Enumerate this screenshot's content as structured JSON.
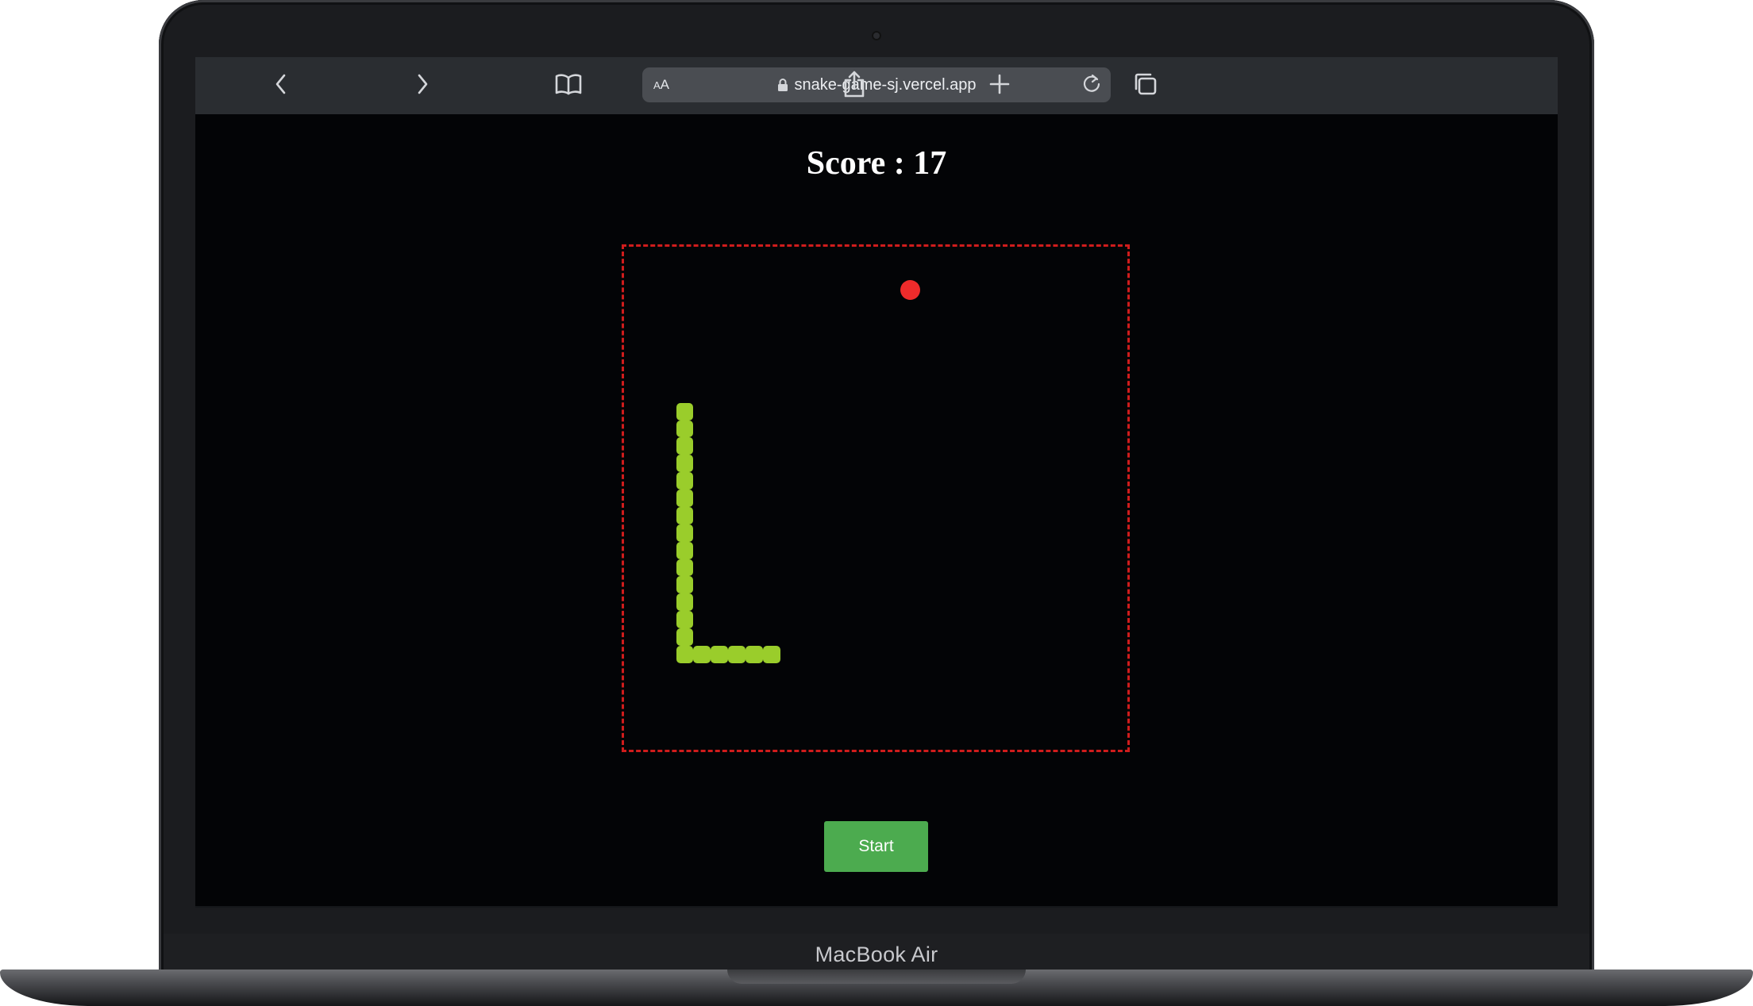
{
  "browser": {
    "text_size_label_small": "A",
    "text_size_label_large": "A",
    "url": "snake-game-sj.vercel.app",
    "icons": {
      "back": "chevron-left-icon",
      "forward": "chevron-right-icon",
      "bookmarks": "book-icon",
      "lock": "lock-icon",
      "reload": "reload-icon",
      "share": "share-icon",
      "new_tab": "plus-icon",
      "tabs": "tabs-icon"
    }
  },
  "game": {
    "score_label": "Score : 17",
    "score": 17,
    "grid_cells": 29,
    "snake_cells": [
      [
        3,
        9
      ],
      [
        3,
        10
      ],
      [
        3,
        11
      ],
      [
        3,
        12
      ],
      [
        3,
        13
      ],
      [
        3,
        14
      ],
      [
        3,
        15
      ],
      [
        3,
        16
      ],
      [
        3,
        17
      ],
      [
        3,
        18
      ],
      [
        3,
        19
      ],
      [
        3,
        20
      ],
      [
        3,
        21
      ],
      [
        3,
        22
      ],
      [
        3,
        23
      ],
      [
        4,
        23
      ],
      [
        5,
        23
      ],
      [
        6,
        23
      ],
      [
        7,
        23
      ],
      [
        8,
        23
      ]
    ],
    "food_cell": [
      16,
      2
    ],
    "start_label": "Start"
  },
  "colors": {
    "snake": "#9acd2b",
    "food": "#ee2b2b",
    "board_border": "#d01c1c",
    "start_button": "#4cab4f",
    "page_background": "#030406"
  },
  "device": {
    "model_label": "MacBook Air"
  }
}
